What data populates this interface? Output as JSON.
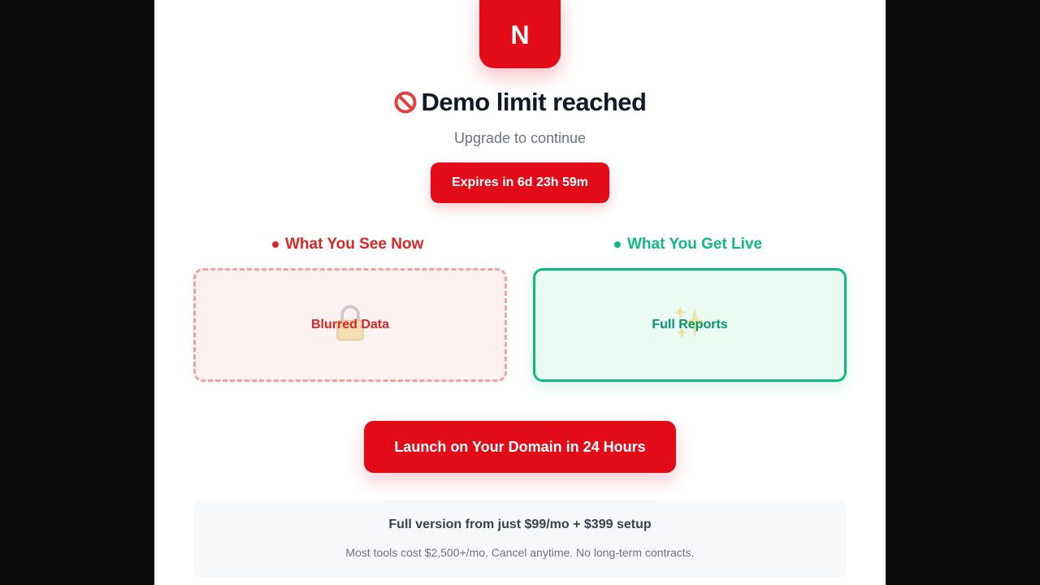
{
  "brand": {
    "logo_letter": "N",
    "accent_color": "#e30b17"
  },
  "header": {
    "title": "Demo limit reached",
    "title_icon": "prohibited-icon",
    "subtitle": "Upgrade to continue",
    "expires_label": "Expires in 6d 23h 59m"
  },
  "comparison": {
    "now": {
      "heading": "What You See Now",
      "card_label": "Blurred Data",
      "icon": "lock-icon",
      "color": "#dc2626"
    },
    "live": {
      "heading": "What You Get Live",
      "card_label": "Full Reports",
      "icon": "sparkles-icon",
      "color": "#10b981"
    }
  },
  "cta": {
    "launch_label": "Launch on Your Domain in 24 Hours"
  },
  "pricing": {
    "headline": "Full version from just $99/mo + $399 setup",
    "note": "Most tools cost $2,500+/mo. Cancel anytime. No long-term contracts."
  }
}
